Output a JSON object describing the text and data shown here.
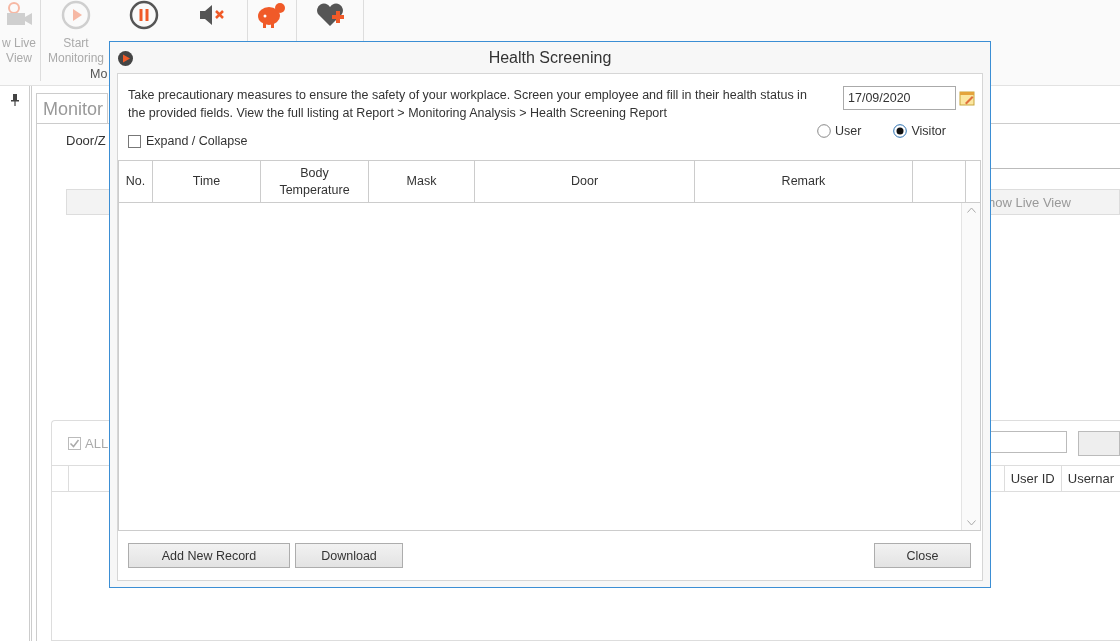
{
  "ribbon": {
    "items": [
      {
        "label": "w Live View",
        "kind": "camera",
        "disabled": true
      },
      {
        "label": "Start Monitoring",
        "kind": "play",
        "disabled": true
      },
      {
        "kind": "pause",
        "disabled": false
      },
      {
        "kind": "mute",
        "disabled": false
      },
      {
        "kind": "piggy",
        "disabled": false
      },
      {
        "kind": "heart",
        "disabled": false
      }
    ],
    "group_label": "Mo"
  },
  "panel": {
    "tab": "Monitor",
    "door_label": "Door/Z",
    "live_view_button": "how Live View",
    "all_checkbox": {
      "label": "ALL",
      "checked": true
    },
    "table_columns": [
      "User ID",
      "Usernar"
    ]
  },
  "dialog": {
    "title": "Health Screening",
    "description": "Take precautionary measures to ensure the safety of your workplace. Screen your employee and fill in their health status in the provided fields. View the full listing at Report > Monitoring Analysis > Health Screening Report",
    "date": "17/09/2020",
    "expand_collapse": {
      "label": "Expand / Collapse",
      "checked": false
    },
    "radios": [
      {
        "label": "User",
        "selected": false
      },
      {
        "label": "Visitor",
        "selected": true
      }
    ],
    "columns": [
      "No.",
      "Time",
      "Body Temperature",
      "Mask",
      "Door",
      "Remark"
    ],
    "buttons": [
      "Add New Record",
      "Download"
    ],
    "close_button": "Close"
  }
}
